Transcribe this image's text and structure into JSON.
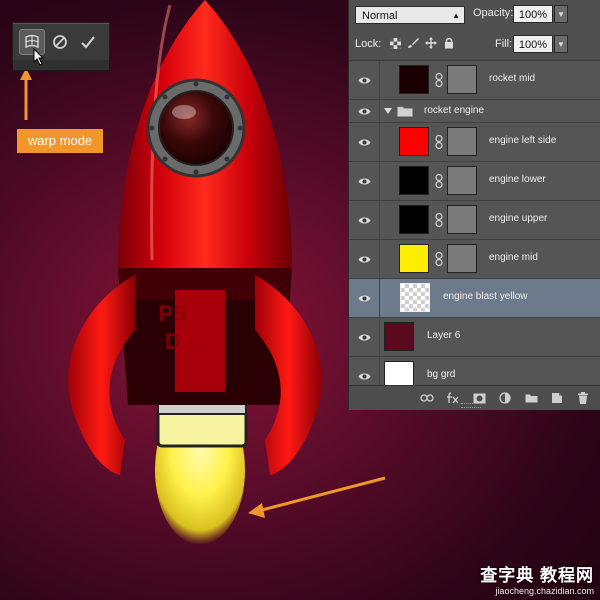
{
  "toolbar": {
    "buttons": [
      {
        "icon": "warp-mode-icon"
      },
      {
        "icon": "cancel-transform-icon"
      },
      {
        "icon": "commit-transform-icon"
      }
    ]
  },
  "annotations": {
    "warp_label": "warp mode"
  },
  "layers_panel": {
    "blend_mode": "Normal",
    "opacity_label": "Opacity:",
    "opacity_value": "100%",
    "lock_label": "Lock:",
    "fill_label": "Fill:",
    "fill_value": "100%",
    "layers": [
      {
        "name": "rocket mid",
        "thumb_color": "#1a0003",
        "has_mask": true,
        "selected": false
      },
      {
        "name": "rocket engine",
        "type": "group"
      },
      {
        "name": "engine left side",
        "thumb_color": "#ff0000",
        "has_mask": true,
        "selected": false
      },
      {
        "name": "engine lower",
        "thumb_color": "#000000",
        "has_mask": true,
        "selected": false
      },
      {
        "name": "engine upper",
        "thumb_color": "#000000",
        "has_mask": true,
        "selected": false
      },
      {
        "name": "engine mid",
        "thumb_color": "#ffee00",
        "has_mask": true,
        "selected": false
      },
      {
        "name": "engine blast yellow",
        "thumb_color": "transparent",
        "has_mask": false,
        "selected": true
      },
      {
        "name": "Layer 6",
        "thumb_color": "#5a0a1e",
        "has_mask": false,
        "selected": false
      },
      {
        "name": "bg grd",
        "thumb_color": "#ffffff",
        "has_mask": false,
        "selected": false
      }
    ],
    "footer_icons": [
      "link-layers-icon",
      "fx-icon",
      "add-mask-icon",
      "adjustment-layer-icon",
      "new-group-icon",
      "new-layer-icon",
      "delete-layer-icon"
    ]
  },
  "rocket": {
    "fin_text": "PSD"
  },
  "watermark": {
    "main": "查字典 教程网",
    "sub": "jiaocheng.chazidian.com"
  },
  "colors": {
    "accent_orange": "#f0962a",
    "rocket_red": "#e00010",
    "panel_bg": "#535353",
    "selected_row": "#6d7a8c"
  }
}
